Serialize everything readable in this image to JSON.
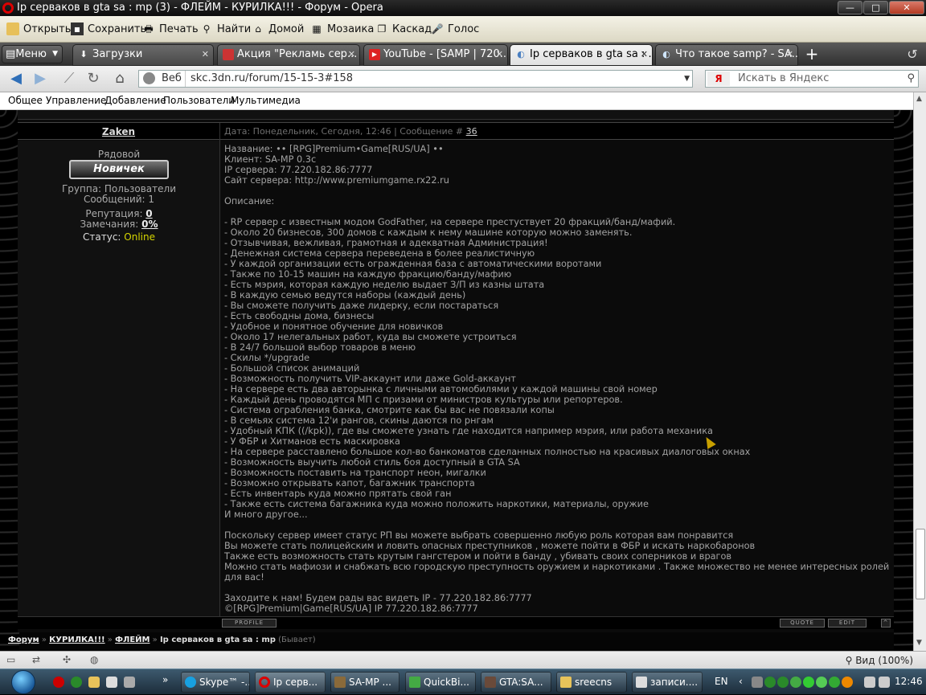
{
  "window": {
    "title": "Ip серваков в gta sa : mp (3) - ФЛЕЙМ - КУРИЛКА!!! - Форум - Opera",
    "buttons": {
      "minimize": "—",
      "maximize": "□",
      "close": "✕"
    }
  },
  "toolbar": {
    "open": "Открыть",
    "save": "Сохранить",
    "print": "Печать",
    "find": "Найти",
    "home": "Домой",
    "mosaic": "Мозаика",
    "cascade": "Каскад",
    "voice": "Голос"
  },
  "tabs": {
    "menu": "Меню",
    "items": [
      {
        "label": "Загрузки"
      },
      {
        "label": "Акция \"Рекламь сер..."
      },
      {
        "label": "YouTube - [SAMP | 720..."
      },
      {
        "label": "Ip серваков в gta sa : ..."
      },
      {
        "label": "Что такое samp? - SA..."
      }
    ],
    "close_glyph": "✕",
    "new_tab": "+"
  },
  "address": {
    "veb_label": "Веб",
    "url": "skc.3dn.ru/forum/15-15-3#158",
    "search_placeholder": "Искать в Яндекс",
    "search_engine": "Я"
  },
  "sitemenu": {
    "items": [
      "Общее",
      "Управление",
      "Добавление",
      "Пользователи",
      "Мультимедиа"
    ]
  },
  "post": {
    "author": "Zaken",
    "meta_prefix": "Дата: Понедельник, Сегодня, 12:46 | Сообщение # ",
    "message_number": "36",
    "rank": "Рядовой",
    "rank_badge": "Новичек",
    "group": "Группа: Пользователи",
    "messages": "Сообщений: 1",
    "reputation_label": "Репутация: ",
    "reputation_value": "0",
    "remarks_label": "Замечания: ",
    "remarks_value": "0%",
    "status_label": "Статус: ",
    "status_value": "Online",
    "body": "Название: •• [RPG]Premium•Game[RUS/UA] ••\nКлиент: SA-MP 0.3c\nIP сервера: 77.220.182.86:7777\nСайт сервера: http://www.premiumgame.rx22.ru\n\nОписание:\n\n- RP сервер с известным модом GodFather, на сервере престуствует 20 фракций/банд/мафий.\n- Около 20 бизнесов, 300 домов с каждым к нему машине которую можно заменять.\n- Отзывчивая, вежливая, грамотная и адекватная Администрация!\n- Денежная система сервера переведена в более реалистичную\n- У каждой организации есть огражденная база с автоматическими воротами\n- Также по 10-15 машин на каждую фракцию/банду/мафию\n- Есть мэрия, которая каждую неделю выдает З/П из казны штата\n- В каждую семью ведутся наборы (каждый день)\n- Вы сможете получить даже лидерку, если постараться\n- Есть свободны дома, бизнесы\n- Удобное и понятное обучение для новичков\n- Около 17 нелегальных работ, куда вы сможете устроиться\n- В 24/7 большой выбор товаров в меню\n- Скилы */upgrade\n- Большой список анимаций\n- Возможность получить VIP-аккаунт или даже Gold-аккаунт\n- На сервере есть два авторынка с личными автомобилями у каждой машины свой номер\n- Каждый день проводятся МП с призами от министров культуры или репортеров.\n- Система ограбления банка, смотрите как бы вас не повязали копы\n- В семьях система 12'и рангов, скины даются по рнгам\n- Удобный КПК ((/kpk)), где вы сможете узнать где находится например мэрия, или работа механика\n- У ФБР и Хитманов есть маскировка\n- На сервере расставлено большое кол-во банкоматов сделанных полностью на красивых диалоговых окнах\n- Возможность выучить любой стиль боя доступный в GTA SA\n- Возможность поставить на транспорт неон, мигалки\n- Возможно открывать капот, багажник транспорта\n- Есть инвентарь куда можно прятать свой ган\n- Также есть система багажника куда можно положить наркотики, материалы, оружие\nИ много другое...\n\nПоскольку сервер имеет статус РП вы можете выбрать совершенно любую роль которая вам понравится\nВы можете стать полицейским и ловить опасных преступников , можете пойти в ФБР и искать наркобаронов\nТакже есть возможность стать крутым гангстером и пойти в банду , убивать своих соперников и врагов\nМожно стать мафиози и снабжать всю городскую преступность оружием и наркотиками . Также множество не менее интересных ролей\nдля вас!\n\nЗаходите к нам! Будем рады вас видеть IP - 77.220.182.86:7777\n©[RPG]Premium|Game[RUS/UA] IP 77.220.182.86:7777",
    "buttons": {
      "profile": "PROFILE",
      "quote": "QUOTE",
      "edit": "EDIT",
      "top": "^"
    }
  },
  "breadcrumb": {
    "forum": "Форум",
    "sep": " » ",
    "section": "КУРИЛКА!!!",
    "subsection": "ФЛЕЙМ",
    "topic": "Ip серваков в gta sa : mp",
    "extra": "(Бывает)"
  },
  "statusbar": {
    "zoom": "Вид (100%)"
  },
  "taskbar": {
    "items": [
      {
        "label": "Skype™ -..."
      },
      {
        "label": "Ip серв..."
      },
      {
        "label": "SA-MP ..."
      },
      {
        "label": "QuickBi..."
      },
      {
        "label": "GTA:SA..."
      },
      {
        "label": "sreecns"
      },
      {
        "label": "записи...."
      }
    ],
    "lang": "EN",
    "time": "12:46"
  }
}
